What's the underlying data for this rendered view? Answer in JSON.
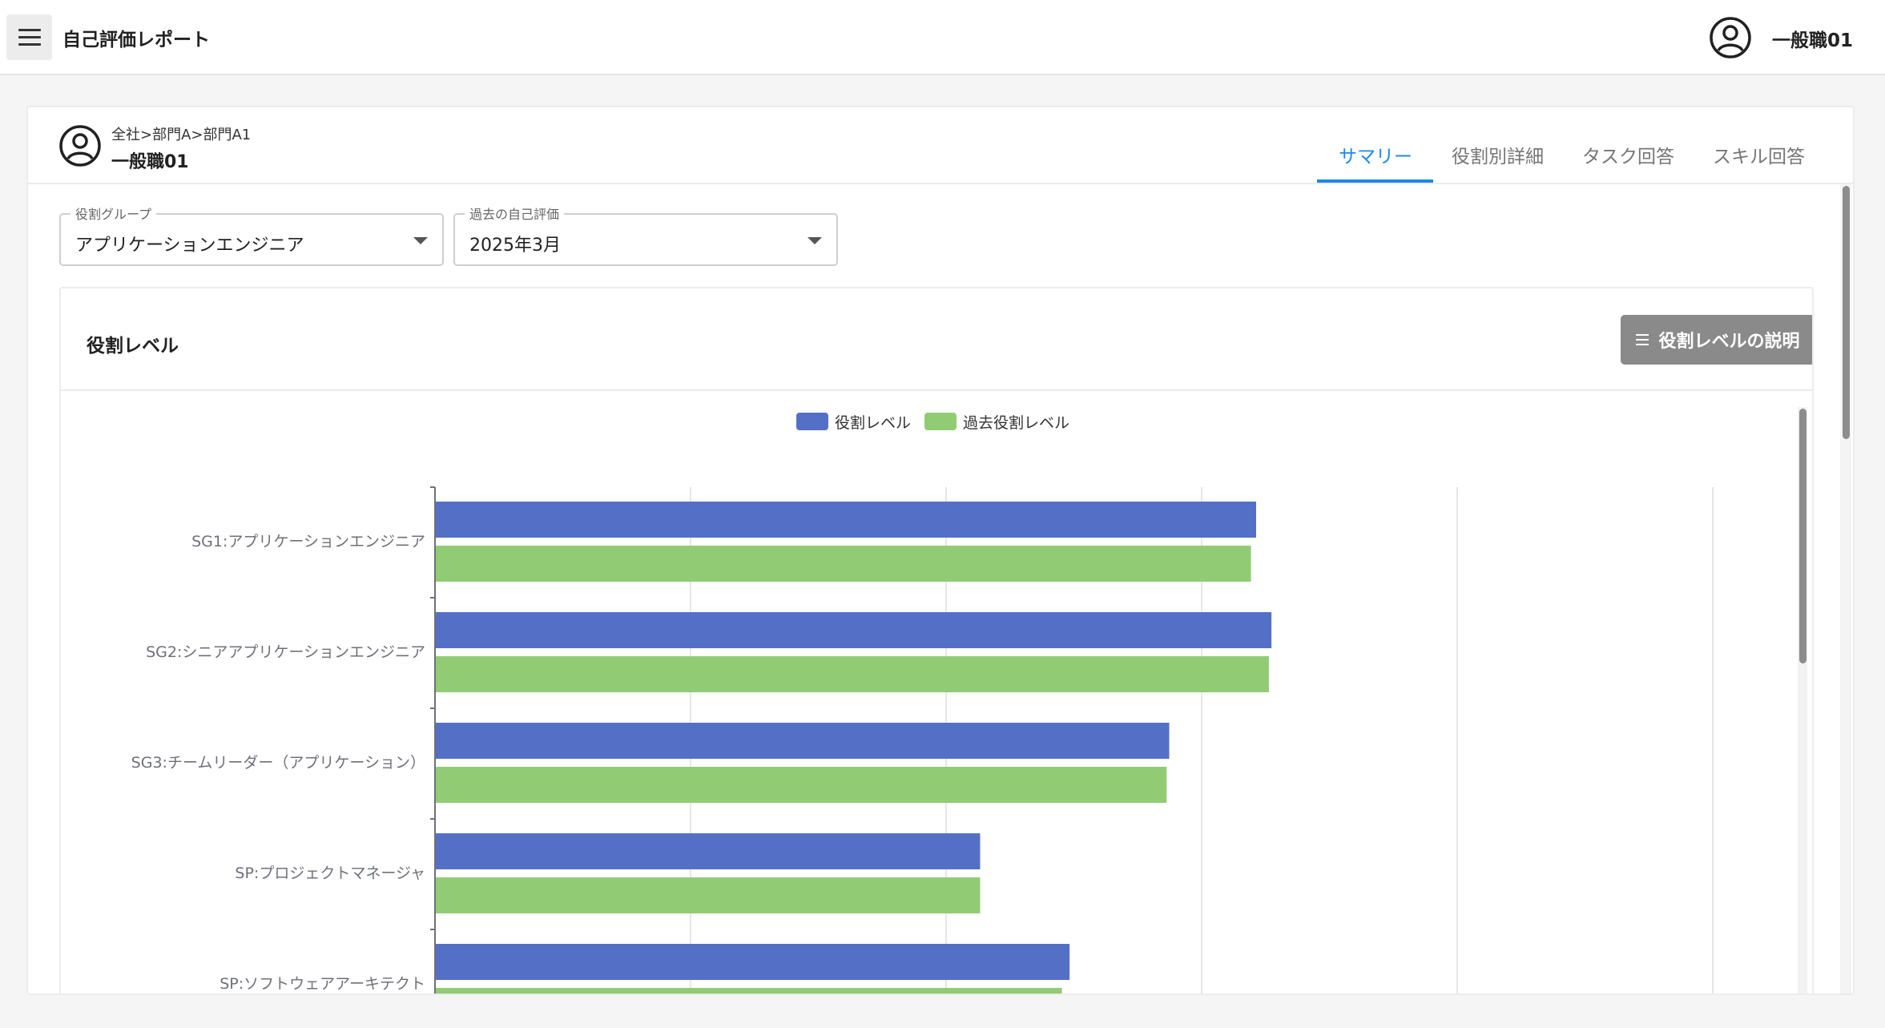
{
  "app": {
    "title": "自己評価レポート",
    "user_name": "一般職01"
  },
  "profile": {
    "org_path": "全社>部門A>部門A1",
    "name": "一般職01"
  },
  "tabs": [
    {
      "label": "サマリー",
      "active": true
    },
    {
      "label": "役割別詳細",
      "active": false
    },
    {
      "label": "タスク回答",
      "active": false
    },
    {
      "label": "スキル回答",
      "active": false
    }
  ],
  "filters": {
    "role_group": {
      "label": "役割グループ",
      "value": "アプリケーションエンジニア"
    },
    "past_eval": {
      "label": "過去の自己評価",
      "value": "2025年3月"
    }
  },
  "section": {
    "title": "役割レベル",
    "explain_button": "役割レベルの説明"
  },
  "icons": {
    "menu": "menu-icon",
    "user": "account-circle-icon",
    "dropdown": "chevron-down-icon",
    "list": "list-icon"
  },
  "colors": {
    "accent": "#1e88e5",
    "series_current": "#5470c6",
    "series_past": "#91cc75",
    "button": "#8a8a8a"
  },
  "chart_data": {
    "type": "bar",
    "orientation": "horizontal",
    "categories": [
      "SG1:アプリケーションエンジニア",
      "SG2:シニアアプリケーションエンジニア",
      "SG3:チームリーダー（アプリケーション）",
      "SP:プロジェクトマネージャ",
      "SP:ソフトウェアアーキテクト"
    ],
    "series": [
      {
        "name": "役割レベル",
        "color": "#5470c6",
        "values": [
          3.21,
          3.27,
          2.87,
          2.13,
          2.48
        ]
      },
      {
        "name": "過去役割レベル",
        "color": "#91cc75",
        "values": [
          3.19,
          3.26,
          2.86,
          2.13,
          2.45
        ]
      }
    ],
    "xlim": [
      0,
      5
    ],
    "grid": true,
    "legend": "top-center"
  }
}
